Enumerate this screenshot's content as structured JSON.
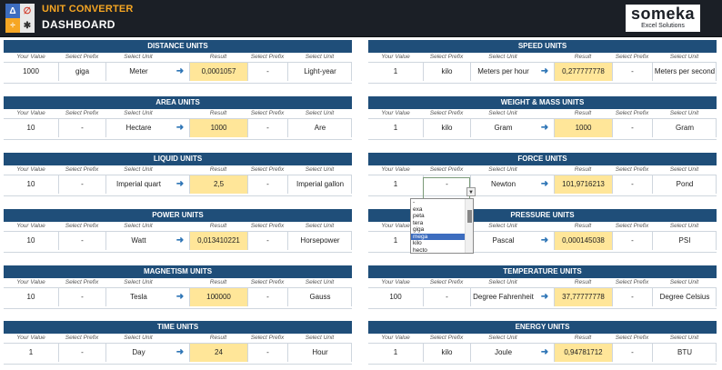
{
  "header": {
    "app_title": "UNIT CONVERTER",
    "page_title": "DASHBOARD",
    "brand_name": "someka",
    "brand_sub": "Excel Solutions",
    "logo_glyphs": [
      "Δ",
      "∅",
      "÷",
      "✱"
    ]
  },
  "col_labels": {
    "your_value": "Your Value",
    "select_prefix": "Select Prefix",
    "select_unit": "Select Unit",
    "result": "Result"
  },
  "arrow_glyph": "➜",
  "panels": [
    {
      "title": "DISTANCE UNITS",
      "value": "1000",
      "prefix1": "giga",
      "unit1": "Meter",
      "result": "0,0001057",
      "prefix2": "-",
      "unit2": "Light-year"
    },
    {
      "title": "SPEED UNITS",
      "value": "1",
      "prefix1": "kilo",
      "unit1": "Meters per hour",
      "result": "0,277777778",
      "prefix2": "-",
      "unit2": "Meters per second"
    },
    {
      "title": "AREA UNITS",
      "value": "10",
      "prefix1": "-",
      "unit1": "Hectare",
      "result": "1000",
      "prefix2": "-",
      "unit2": "Are"
    },
    {
      "title": "WEIGHT & MASS UNITS",
      "value": "1",
      "prefix1": "kilo",
      "unit1": "Gram",
      "result": "1000",
      "prefix2": "-",
      "unit2": "Gram"
    },
    {
      "title": "LIQUID UNITS",
      "value": "10",
      "prefix1": "-",
      "unit1": "Imperial quart",
      "result": "2,5",
      "prefix2": "-",
      "unit2": "Imperial gallon"
    },
    {
      "title": "FORCE UNITS",
      "value": "1",
      "prefix1": "-",
      "unit1": "Newton",
      "result": "101,9716213",
      "prefix2": "-",
      "unit2": "Pond"
    },
    {
      "title": "POWER UNITS",
      "value": "10",
      "prefix1": "-",
      "unit1": "Watt",
      "result": "0,013410221",
      "prefix2": "-",
      "unit2": "Horsepower"
    },
    {
      "title": "PRESSURE UNITS",
      "value": "1",
      "prefix1": "",
      "unit1": "Pascal",
      "result": "0,000145038",
      "prefix2": "-",
      "unit2": "PSI"
    },
    {
      "title": "MAGNETISM UNITS",
      "value": "10",
      "prefix1": "-",
      "unit1": "Tesla",
      "result": "100000",
      "prefix2": "-",
      "unit2": "Gauss"
    },
    {
      "title": "TEMPERATURE UNITS",
      "value": "100",
      "prefix1": "-",
      "unit1": "Degree Fahrenheit",
      "result": "37,77777778",
      "prefix2": "-",
      "unit2": "Degree Celsius"
    },
    {
      "title": "TIME UNITS",
      "value": "1",
      "prefix1": "-",
      "unit1": "Day",
      "result": "24",
      "prefix2": "-",
      "unit2": "Hour"
    },
    {
      "title": "ENERGY UNITS",
      "value": "1",
      "prefix1": "kilo",
      "unit1": "Joule",
      "result": "0,94781712",
      "prefix2": "-",
      "unit2": "BTU"
    }
  ],
  "dropdown": {
    "options": [
      "-",
      "exa",
      "peta",
      "tera",
      "giga",
      "mega",
      "kilo",
      "hecto"
    ],
    "selected": "mega",
    "arrow_glyph": "▼"
  }
}
